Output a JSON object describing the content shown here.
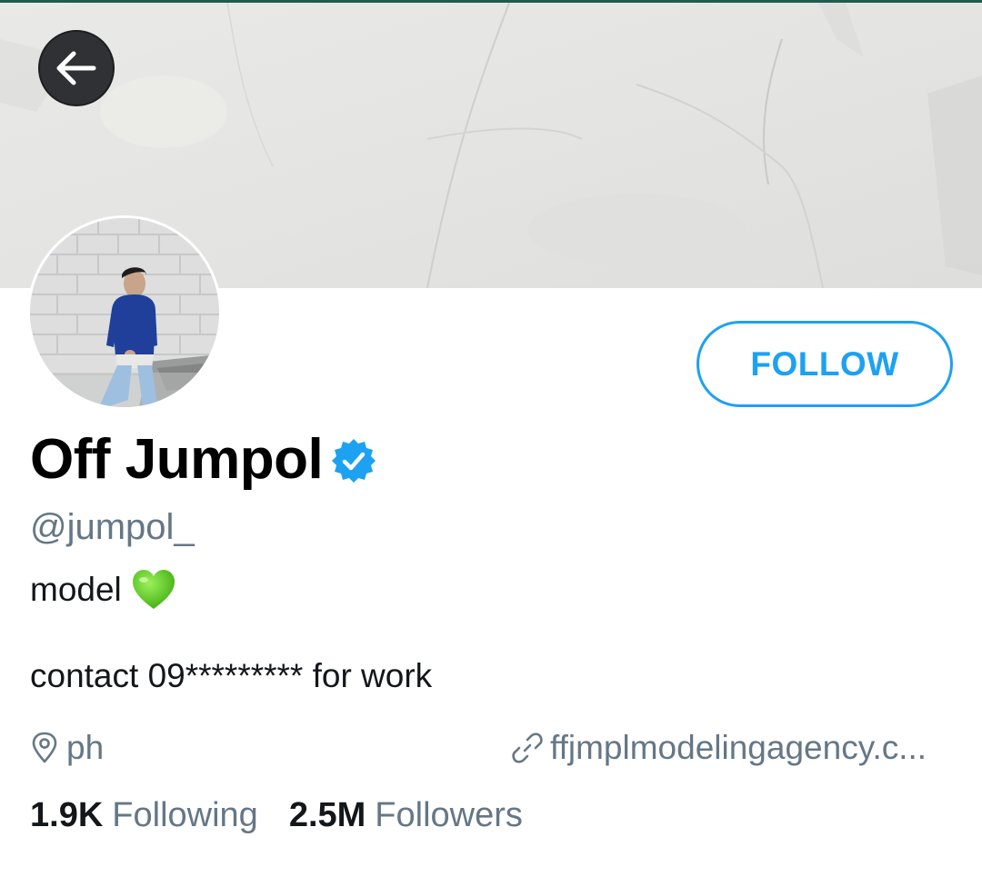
{
  "profile": {
    "display_name": "Off Jumpol",
    "handle": "@jumpol_",
    "verified": true,
    "bio_line1": "model",
    "bio_emoji": "green-heart-emoji",
    "bio_line2": "contact 09********* for work",
    "location": "ph",
    "website": "ffjmplmodelingagency.c..."
  },
  "actions": {
    "follow_label": "FOLLOW"
  },
  "stats": {
    "following_count": "1.9K",
    "following_label": "Following",
    "followers_count": "2.5M",
    "followers_label": "Followers"
  },
  "icons": {
    "back": "arrow-left-icon",
    "verified": "verified-badge-icon",
    "location": "location-pin-icon",
    "link": "link-icon"
  },
  "colors": {
    "accent": "#1da1f2",
    "secondary_text": "#657786",
    "heart": "#5fd12a"
  }
}
